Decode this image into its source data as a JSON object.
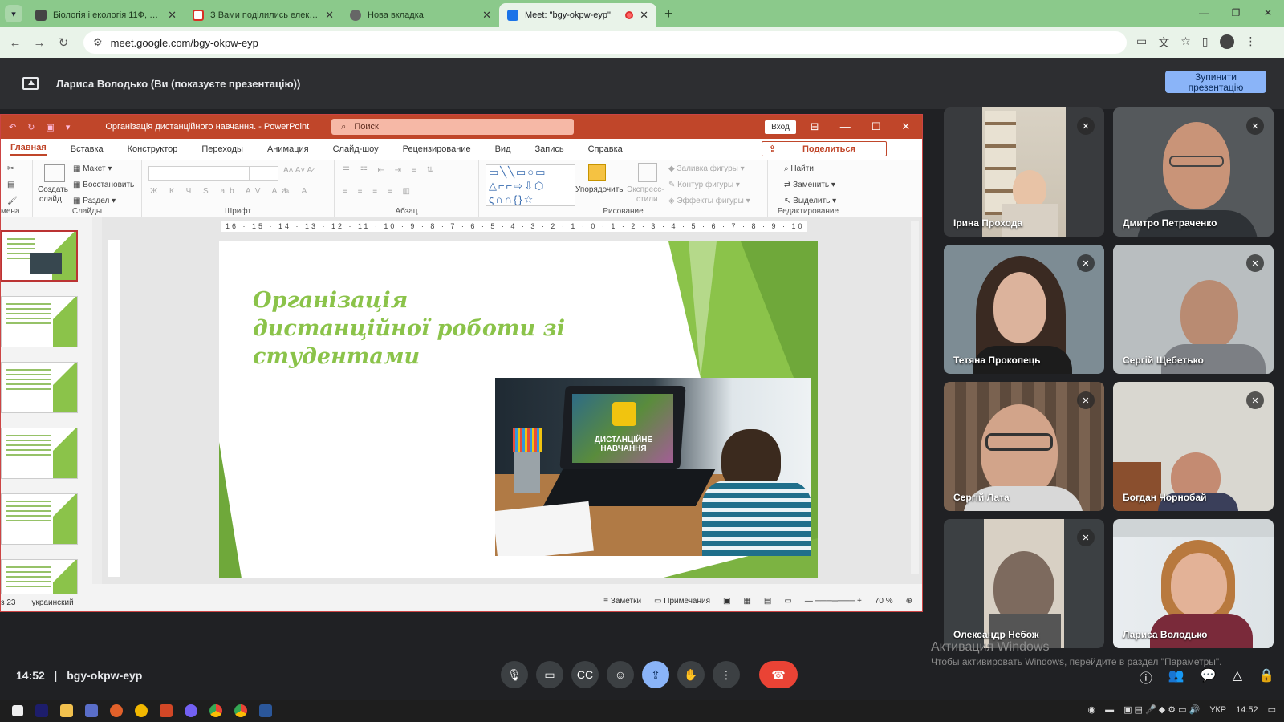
{
  "browser": {
    "tabs": [
      {
        "title": "Біологія і екологія 11Ф, БО",
        "color": "#444444"
      },
      {
        "title": "З Вами поділились електронн",
        "color": "#d93025"
      },
      {
        "title": "Нова вкладка",
        "color": "#555555"
      },
      {
        "title": "Meet: \"bgy-okpw-eyp\"",
        "color": "#1a73e8",
        "active": true
      }
    ],
    "url": "meet.google.com/bgy-okpw-eyp"
  },
  "banner": {
    "text": "Лариса Володько (Ви (показуєте презентацію))",
    "stop_label_1": "Зупинити",
    "stop_label_2": "презентацію"
  },
  "ppt": {
    "doc_title": "Організація дистанційного навчання.  -  PowerPoint",
    "search_placeholder": "Поиск",
    "login_label": "Вход",
    "menu": [
      "Главная",
      "Вставка",
      "Конструктор",
      "Переходы",
      "Анимация",
      "Слайд-шоу",
      "Рецензирование",
      "Вид",
      "Запись",
      "Справка"
    ],
    "share_label": "Поделиться",
    "groups": {
      "clipboard": "мена",
      "slides": "Слайды",
      "font": "Шрифт",
      "paragraph": "Абзац",
      "drawing": "Рисование",
      "editing": "Редактирование"
    },
    "ribbon": {
      "create_1": "Создать",
      "create_2": "слайд",
      "layout": "Макет",
      "reset": "Восстановить",
      "section": "Раздел",
      "arrange": "Упорядочить",
      "express_1": "Экспресс-",
      "express_2": "стили",
      "fill": "Заливка фигуры",
      "outline": "Контур фигуры",
      "effects": "Эффекты фигуры",
      "find": "Найти",
      "replace": "Заменить",
      "select": "Выделить"
    },
    "ruler": "16 · 15 · 14 · 13 · 12 · 11 · 10 · 9 · 8 · 7 · 6 · 5 · 4 · 3 · 2 · 1 · 0 · 1 · 2 · 3 · 4 · 5 · 6 · 7 · 8 · 9 · 10 · 11 · 12 · 13 · 14 · 15 · 16",
    "slide_title": "Організація дистанційної роботи зі студентами",
    "photo_caption": "ДИСТАНЦІЙНЕ НАВЧАННЯ",
    "status": {
      "slides": "з 23",
      "lang": "украинский",
      "notes": "Заметки",
      "comments": "Примечания",
      "zoom": "70 %"
    }
  },
  "participants": [
    {
      "name": "Ірина Прохода",
      "muted": true
    },
    {
      "name": "Дмитро Петраченко",
      "muted": true
    },
    {
      "name": "Тетяна Прокопець",
      "muted": true
    },
    {
      "name": "Сергій Щебетько",
      "muted": true
    },
    {
      "name": "Сергій Лата",
      "muted": true
    },
    {
      "name": "Богдан Чорнобай",
      "muted": true
    },
    {
      "name": "Олександр Небож",
      "muted": true
    },
    {
      "name": "Лариса Володько",
      "muted": false
    }
  ],
  "windows_activation": {
    "title": "Активация Windows",
    "text": "Чтобы активировать Windows, перейдите в раздел \"Параметры\"."
  },
  "meet": {
    "time": "14:52",
    "separator": "|",
    "code": "bgy-okpw-eyp"
  },
  "taskbar": {
    "lang": "УКР",
    "time": "14:52"
  },
  "colors": {
    "chrome_tabstrip": "#8bc98b",
    "ppt_accent": "#c0462a",
    "slide_green": "#8bc34a",
    "meet_blue": "#8ab4f8",
    "end_call": "#ea4335"
  }
}
